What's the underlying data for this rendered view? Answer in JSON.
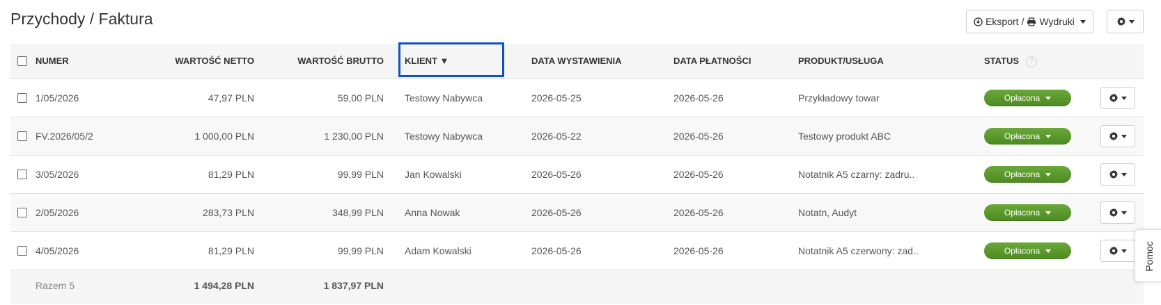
{
  "page": {
    "title": "Przychody / Faktura"
  },
  "toolbar": {
    "export_label": "Eksport",
    "separator": "/",
    "print_label": "Wydruki"
  },
  "table": {
    "columns": {
      "numer": "NUMER",
      "netto": "WARTOŚĆ NETTO",
      "brutto": "WARTOŚĆ BRUTTO",
      "klient": "KLIENT ▼",
      "data_wystawienia": "DATA WYSTAWIENIA",
      "data_platnosci": "DATA PŁATNOŚCI",
      "produkt": "PRODUKT/USŁUGA",
      "status": "STATUS",
      "status_help": "?"
    },
    "rows": [
      {
        "numer": "1/05/2026",
        "netto": "47,97 PLN",
        "brutto": "59,00 PLN",
        "klient": "Testowy Nabywca",
        "data_wystawienia": "2026-05-25",
        "data_platnosci": "2026-05-26",
        "produkt": "Przykładowy towar",
        "status": "Opłacona"
      },
      {
        "numer": "FV.2026/05/2",
        "netto": "1 000,00 PLN",
        "brutto": "1 230,00 PLN",
        "klient": "Testowy Nabywca",
        "data_wystawienia": "2026-05-22",
        "data_platnosci": "2026-05-26",
        "produkt": "Testowy produkt ABC",
        "status": "Opłacona"
      },
      {
        "numer": "3/05/2026",
        "netto": "81,29 PLN",
        "brutto": "99,99 PLN",
        "klient": "Jan Kowalski",
        "data_wystawienia": "2026-05-26",
        "data_platnosci": "2026-05-26",
        "produkt": "Notatnik A5 czarny: zadru..",
        "status": "Opłacona"
      },
      {
        "numer": "2/05/2026",
        "netto": "283,73 PLN",
        "brutto": "348,99 PLN",
        "klient": "Anna Nowak",
        "data_wystawienia": "2026-05-26",
        "data_platnosci": "2026-05-26",
        "produkt": "Notatn, Audyt",
        "status": "Opłacona"
      },
      {
        "numer": "4/05/2026",
        "netto": "81,29 PLN",
        "brutto": "99,99 PLN",
        "klient": "Adam Kowalski",
        "data_wystawienia": "2026-05-26",
        "data_platnosci": "2026-05-26",
        "produkt": "Notatnik A5 czerwony: zad..",
        "status": "Opłacona"
      }
    ],
    "footer": {
      "label": "Razem 5",
      "netto_total": "1 494,28 PLN",
      "brutto_total": "1 837,97 PLN"
    }
  },
  "help_tab": {
    "label": "Pomoc"
  },
  "colors": {
    "status_paid": "#5a9a2c",
    "highlight_border": "#1050c8",
    "header_bg": "#f5f5f5"
  }
}
